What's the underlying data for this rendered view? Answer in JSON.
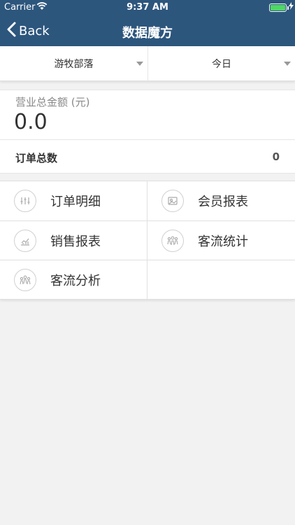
{
  "status_bar": {
    "carrier": "Carrier",
    "time": "9:37 AM"
  },
  "nav": {
    "back_label": "Back",
    "title": "数据魔方"
  },
  "filters": {
    "store": "游牧部落",
    "period": "今日"
  },
  "summary": {
    "sales_label": "营业总金额 (元)",
    "sales_value": "0.0",
    "orders_label": "订单总数",
    "orders_value": "0"
  },
  "menu": {
    "order_detail": "订单明细",
    "member_report": "会员报表",
    "sales_report": "销售报表",
    "traffic_stats": "客流统计",
    "traffic_analysis": "客流分析"
  },
  "colors": {
    "header": "#2d567d",
    "battery": "#4cd964"
  }
}
